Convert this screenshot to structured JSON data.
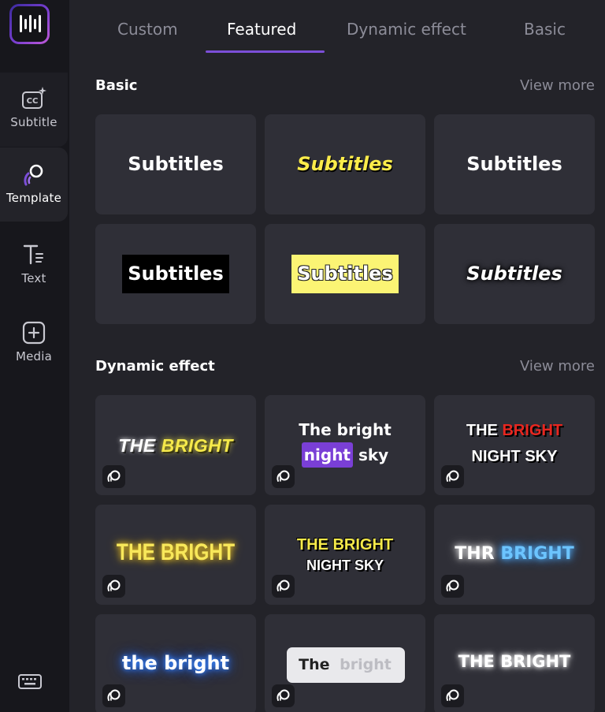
{
  "sidebar": {
    "items": [
      {
        "label": "Subtitle",
        "icon": "cc-sparkle-icon"
      },
      {
        "label": "Template",
        "icon": "template-icon"
      },
      {
        "label": "Text",
        "icon": "text-icon"
      },
      {
        "label": "Media",
        "icon": "add-media-icon"
      }
    ],
    "footer_icon": "keyboard-icon"
  },
  "tabs": [
    {
      "label": "Custom"
    },
    {
      "label": "Featured",
      "active": true
    },
    {
      "label": "Dynamic effect"
    },
    {
      "label": "Basic"
    }
  ],
  "sections": {
    "basic": {
      "title": "Basic",
      "view_more": "View more",
      "cards": [
        "Subtitles",
        "Subtitles",
        "Subtitles",
        "Subtitles",
        "Subtitles",
        "Subtitles"
      ]
    },
    "dynamic": {
      "title": "Dynamic effect",
      "view_more": "View more",
      "cards": [
        {
          "a": "THE",
          "b": "BRIGHT"
        },
        {
          "line1": "The bright",
          "hl": "night",
          "rest": "sky"
        },
        {
          "a": "THE",
          "b": "BRIGHT",
          "line2": "NIGHT SKY"
        },
        {
          "line1": "THE BRIGHT"
        },
        {
          "line1": "THE BRIGHT",
          "line2": "NIGHT SKY"
        },
        {
          "a": "THR",
          "b": "BRIGHT"
        },
        {
          "line1": "the bright"
        },
        {
          "a": "The",
          "b": "bright"
        },
        {
          "line1": "THE BRIGHT"
        }
      ]
    }
  },
  "colors": {
    "accent": "#7c4fd8",
    "yellow": "#f5e94a",
    "red": "#e8261f",
    "blue_glow": "#58b8ff"
  }
}
